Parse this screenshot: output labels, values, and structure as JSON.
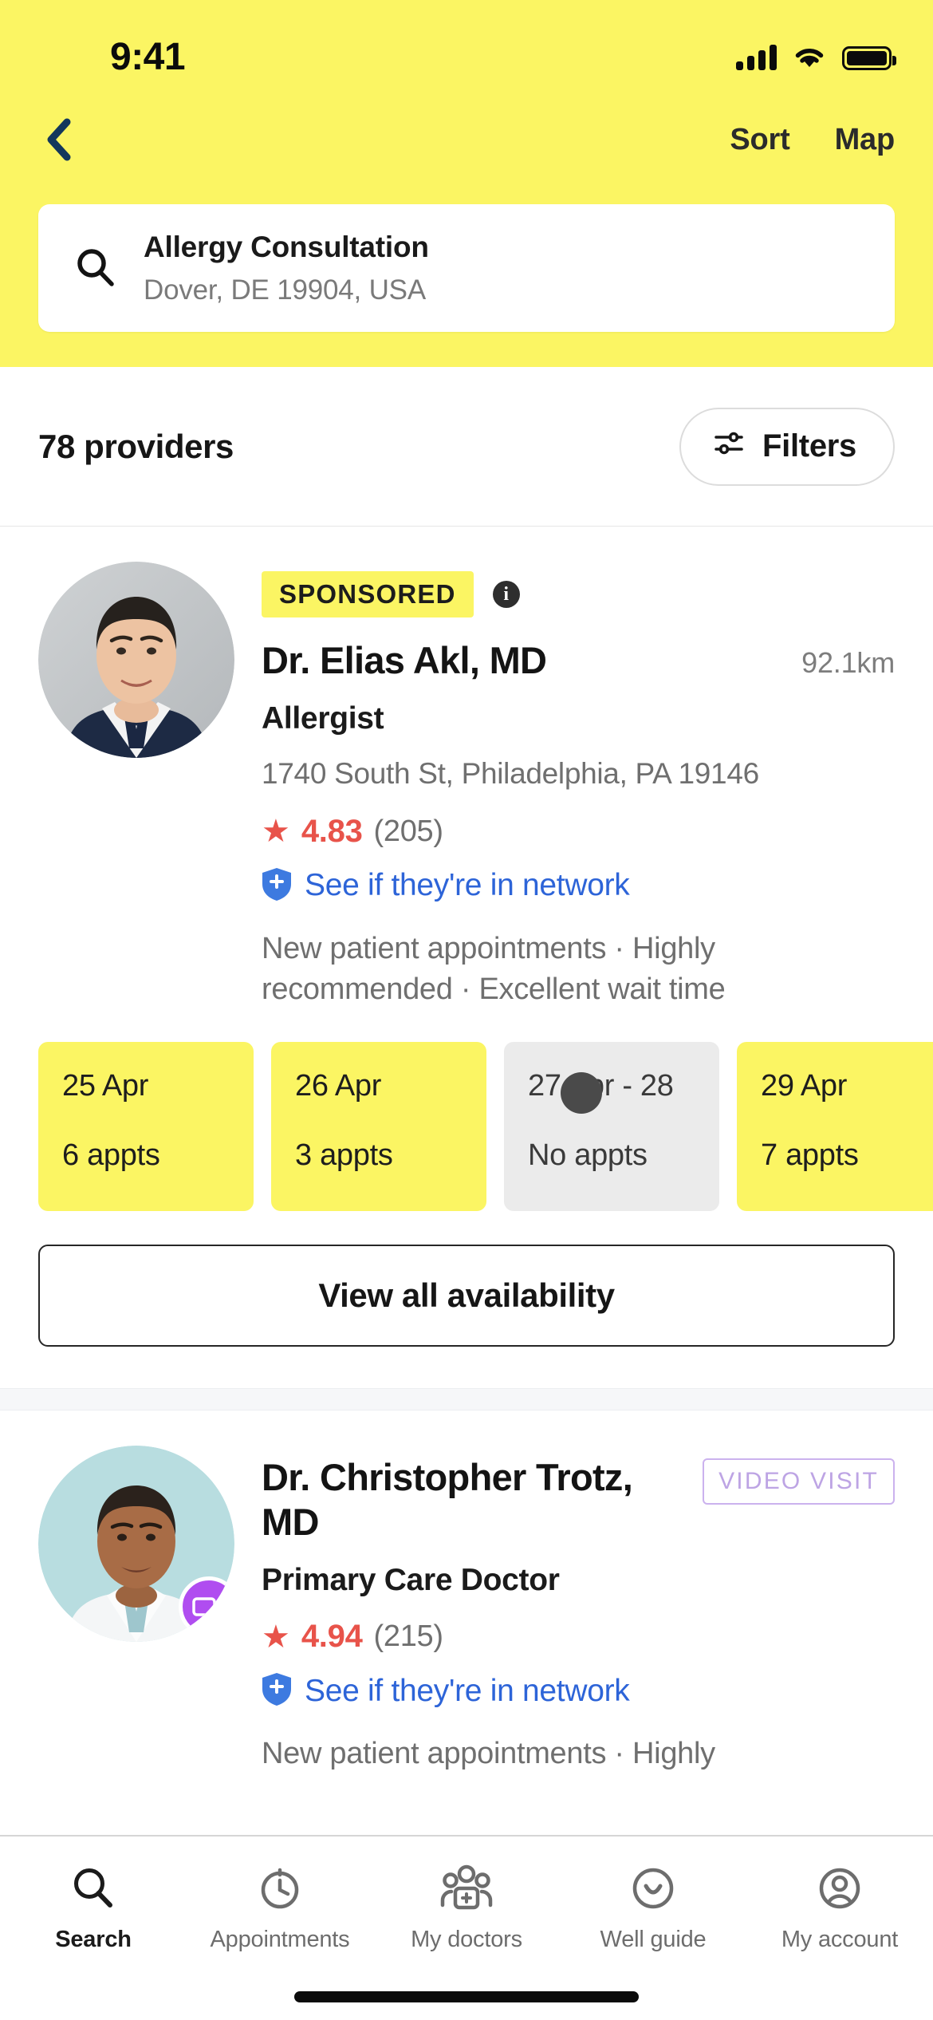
{
  "status_bar": {
    "time": "9:41",
    "icons": [
      "cellular-signal-icon",
      "wifi-icon",
      "battery-icon"
    ]
  },
  "header": {
    "back_label": "back-chevron",
    "sort_label": "Sort",
    "map_label": "Map",
    "accent_color": "#FBF563",
    "search": {
      "icon": "search-icon",
      "query": "Allergy Consultation",
      "location": "Dover, DE 19904, USA"
    }
  },
  "results_bar": {
    "count_label": "78 providers",
    "filters_label": "Filters",
    "filters_icon": "sliders-icon"
  },
  "providers": [
    {
      "sponsored_label": "SPONSORED",
      "info_icon": "info-icon",
      "name": "Dr. Elias Akl, MD",
      "distance": "92.1km",
      "specialty": "Allergist",
      "address": "1740 South St, Philadelphia, PA 19146",
      "rating": "4.83",
      "review_count": "(205)",
      "rating_color": "#e8534a",
      "network_link": "See if they're in network",
      "network_icon": "shield-plus-icon",
      "link_color": "#2d64d8",
      "tags": "New patient appointments · Highly recommended · Excellent wait time",
      "appointments": [
        {
          "date": "25 Apr",
          "count": "6 appts",
          "available": true
        },
        {
          "date": "26 Apr",
          "count": "3 appts",
          "available": true
        },
        {
          "date": "27 Apr - 28",
          "count": "No appts",
          "available": false
        },
        {
          "date": "29 Apr",
          "count": "7 appts",
          "available": true
        }
      ],
      "view_all_label": "View all availability"
    },
    {
      "name": "Dr. Christopher Trotz, MD",
      "video_badge": "VIDEO VISIT",
      "video_icon": "video-camera-icon",
      "specialty": "Primary Care Doctor",
      "rating": "4.94",
      "review_count": "(215)",
      "network_link": "See if they're in network",
      "network_icon": "shield-plus-icon",
      "tags": "New patient appointments · Highly"
    }
  ],
  "tab_bar": {
    "items": [
      {
        "label": "Search",
        "icon": "search-icon",
        "active": true
      },
      {
        "label": "Appointments",
        "icon": "clock-icon",
        "active": false
      },
      {
        "label": "My doctors",
        "icon": "people-plus-icon",
        "active": false
      },
      {
        "label": "Well guide",
        "icon": "smiley-icon",
        "active": false
      },
      {
        "label": "My account",
        "icon": "user-circle-icon",
        "active": false
      }
    ]
  }
}
